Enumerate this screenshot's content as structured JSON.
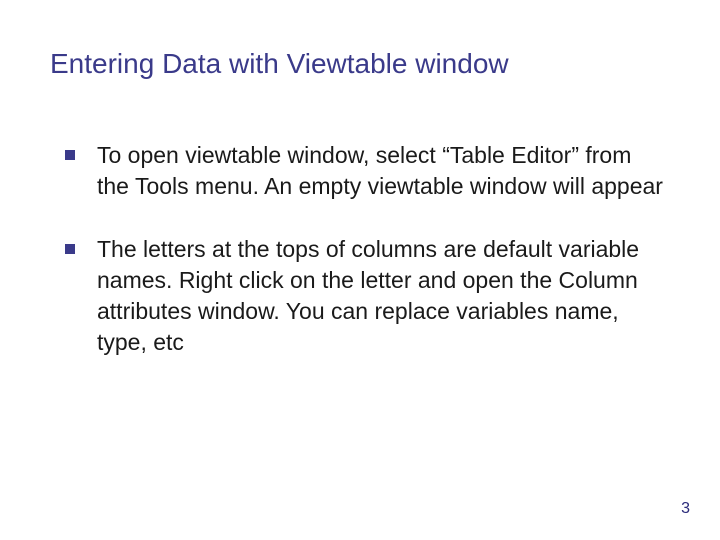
{
  "slide": {
    "title": "Entering Data with Viewtable window",
    "bullets": [
      "To open viewtable window, select “Table Editor” from the Tools menu. An empty viewtable window will appear",
      "The letters at the tops of columns are default variable names. Right click on the letter and open the Column attributes window. You can replace variables name, type, etc"
    ],
    "pageNumber": "3"
  }
}
